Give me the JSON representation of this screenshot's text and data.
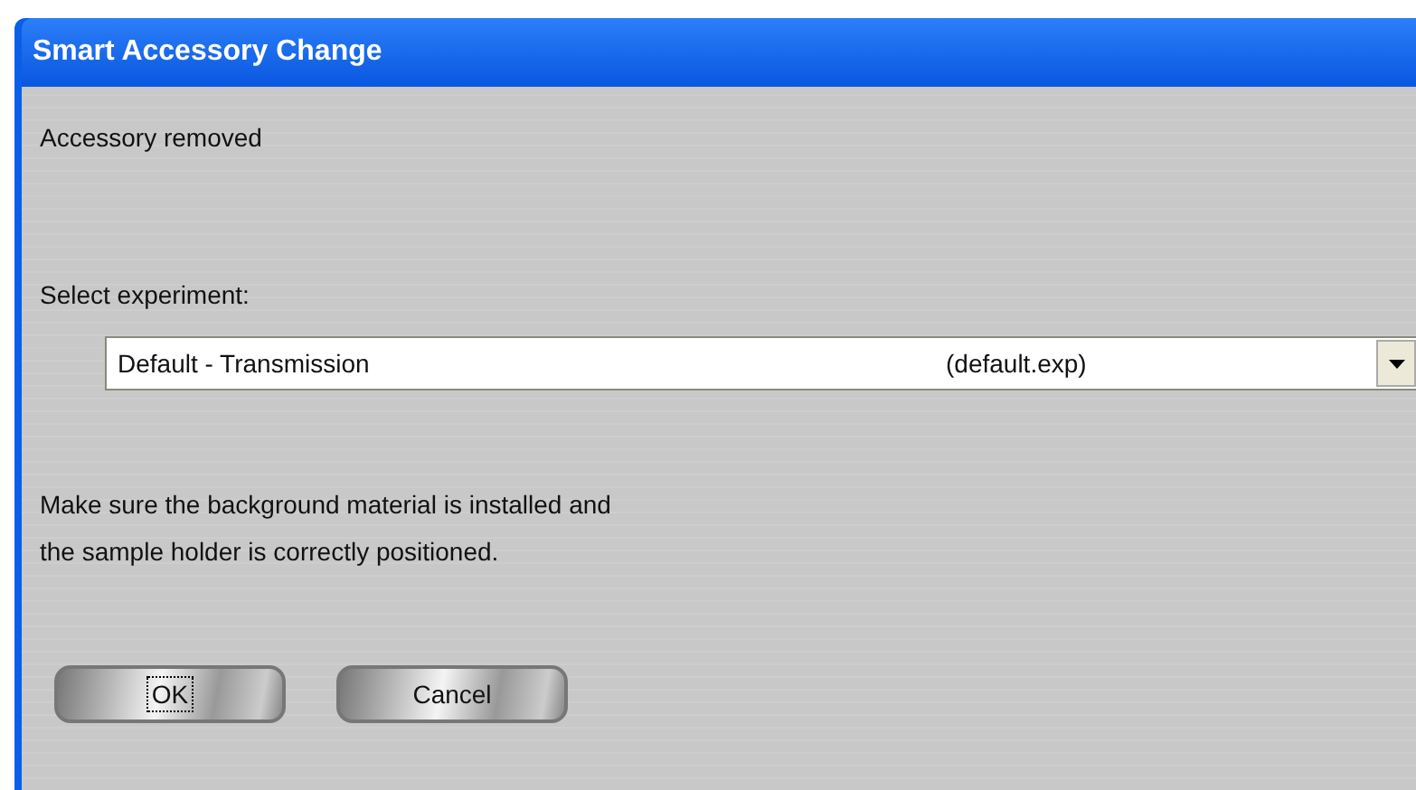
{
  "window": {
    "title": "Smart Accessory Change"
  },
  "status": "Accessory removed",
  "experiment": {
    "label": "Select experiment:",
    "value_name": "Default - Transmission",
    "value_file": "(default.exp)"
  },
  "message": [
    "Make sure the background material is installed and",
    "the sample holder is correctly positioned."
  ],
  "buttons": [
    {
      "label": "OK",
      "focused": true
    },
    {
      "label": "Cancel",
      "focused": false
    }
  ]
}
